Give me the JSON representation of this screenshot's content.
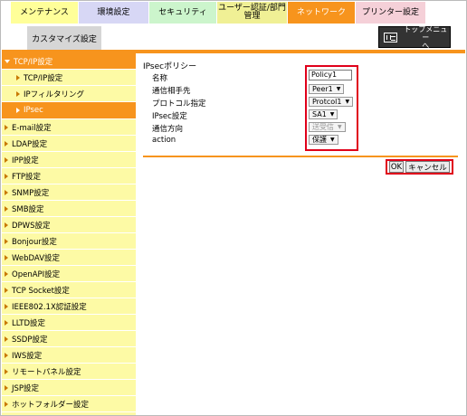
{
  "tabs": [
    {
      "label": "メンテナンス",
      "color": "#ffff99"
    },
    {
      "label": "環境設定",
      "color": "#d7d7f5"
    },
    {
      "label": "セキュリティ",
      "color": "#ccf5cc"
    },
    {
      "label": "ユーザー認証/部門\n管理",
      "color": "#f0f095"
    },
    {
      "label": "ネットワーク",
      "color": "#f7941d"
    },
    {
      "label": "プリンター設定",
      "color": "#f5d0d8"
    }
  ],
  "subtab": "カスタマイズ設定",
  "top_menu": "トップメニュー\nへ",
  "sidebar": [
    {
      "label": "TCP/IP設定"
    },
    {
      "label": "TCP/IP設定"
    },
    {
      "label": "IPフィルタリング"
    },
    {
      "label": "IPsec"
    },
    {
      "label": "E-mail設定"
    },
    {
      "label": "LDAP設定"
    },
    {
      "label": "IPP設定"
    },
    {
      "label": "FTP設定"
    },
    {
      "label": "SNMP設定"
    },
    {
      "label": "SMB設定"
    },
    {
      "label": "DPWS設定"
    },
    {
      "label": "Bonjour設定"
    },
    {
      "label": "WebDAV設定"
    },
    {
      "label": "OpenAPI設定"
    },
    {
      "label": "TCP Socket設定"
    },
    {
      "label": "IEEE802.1X認証設定"
    },
    {
      "label": "LLTD設定"
    },
    {
      "label": "SSDP設定"
    },
    {
      "label": "IWS設定"
    },
    {
      "label": "リモートパネル設定"
    },
    {
      "label": "JSP設定"
    },
    {
      "label": "ホットフォルダー設定"
    }
  ],
  "form": {
    "title": "IPsecポリシー",
    "name_label": "名称",
    "name_value": "Policy1",
    "peer_label": "通信相手先",
    "peer_value": "Peer1",
    "protocol_label": "プロトコル指定",
    "protocol_value": "Protcol1",
    "ipsec_label": "IPsec設定",
    "ipsec_value": "SA1",
    "direction_label": "通信方向",
    "direction_value": "送受信",
    "action_label": "action",
    "action_value": "保護"
  },
  "buttons": {
    "ok": "OK",
    "cancel": "キャンセル"
  },
  "colors": {
    "accent": "#f7941d",
    "sidebar_bg": "#fdfaa5",
    "highlight": "#e0001a"
  }
}
